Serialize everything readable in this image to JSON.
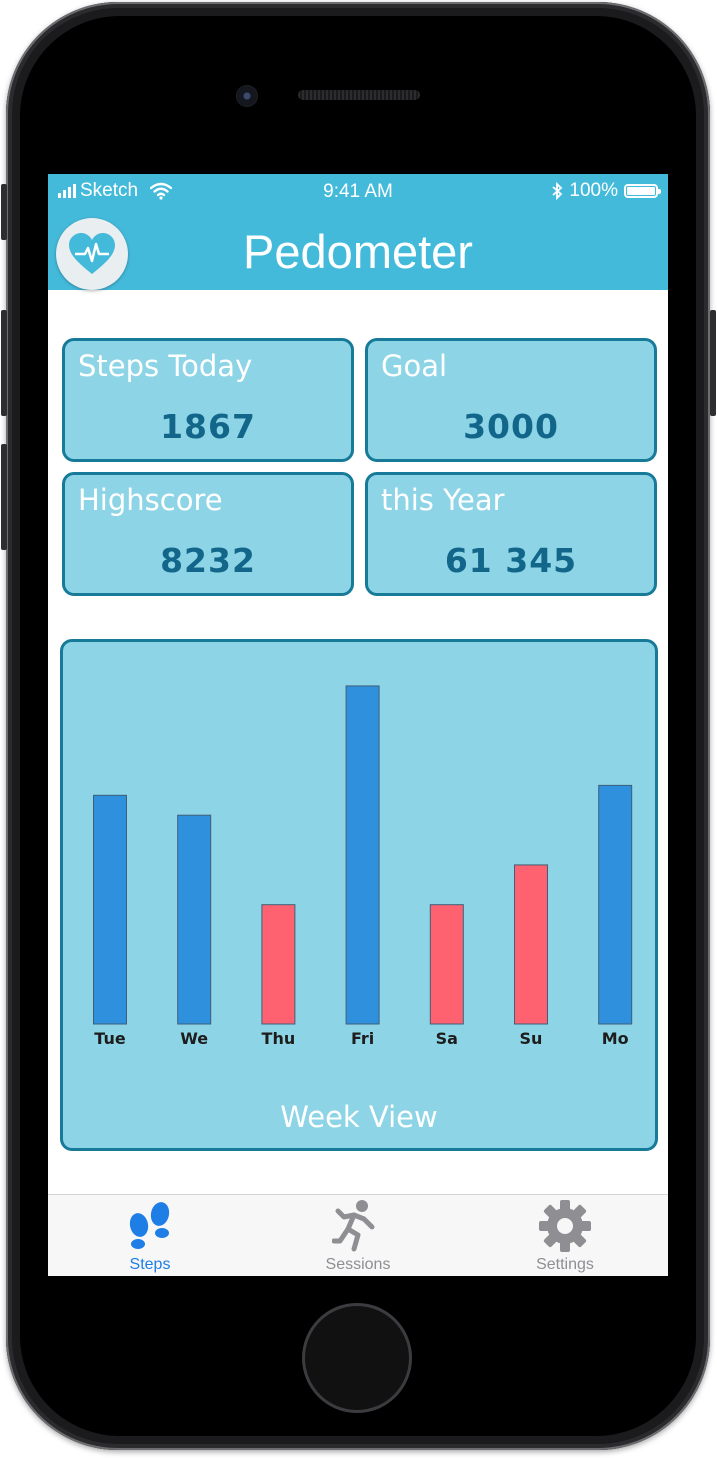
{
  "status_bar": {
    "carrier": "Sketch",
    "time": "9:41 AM",
    "battery": "100%"
  },
  "header": {
    "title": "Pedometer",
    "logo_icon": "heart-pulse-icon"
  },
  "stats": {
    "steps_today": {
      "label": "Steps Today",
      "value": "1867"
    },
    "goal": {
      "label": "Goal",
      "value": "3000"
    },
    "highscore": {
      "label": "Highscore",
      "value": "8232"
    },
    "this_year": {
      "label": "this Year",
      "value": "61 345"
    }
  },
  "chart_data": {
    "type": "bar",
    "title": "Week View",
    "categories": [
      "Tue",
      "We",
      "Thu",
      "Fri",
      "Sa",
      "Su",
      "Mo"
    ],
    "values": [
      230,
      210,
      120,
      340,
      120,
      160,
      240
    ],
    "colors": [
      "#2f90de",
      "#2f90de",
      "#fe6270",
      "#2f90de",
      "#fe6270",
      "#fe6270",
      "#2f90de"
    ],
    "ylim": [
      0,
      350
    ],
    "grid": false,
    "legend": "none"
  },
  "tabbar": {
    "tabs": [
      {
        "label": "Steps",
        "icon": "footprints-icon",
        "active": true
      },
      {
        "label": "Sessions",
        "icon": "running-person-icon",
        "active": false
      },
      {
        "label": "Settings",
        "icon": "gear-icon",
        "active": false
      }
    ]
  },
  "colors": {
    "header": "#44badb",
    "card_bg": "#8dd5e6",
    "card_border": "#177a99",
    "value_text": "#12668a",
    "bar_blue": "#2f90de",
    "bar_red": "#fe6270",
    "tab_active": "#1e7ee6"
  }
}
